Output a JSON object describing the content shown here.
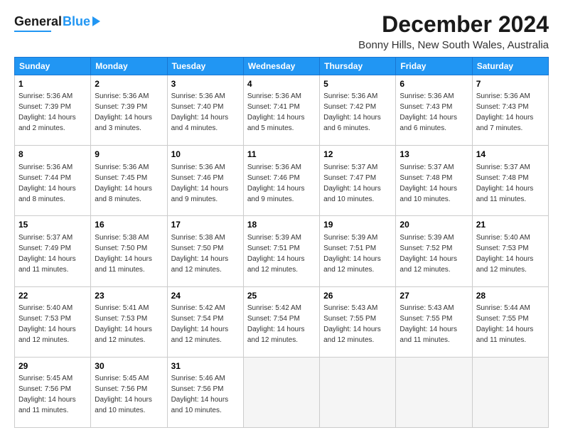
{
  "header": {
    "logo_general": "General",
    "logo_blue": "Blue",
    "title": "December 2024",
    "subtitle": "Bonny Hills, New South Wales, Australia"
  },
  "days_of_week": [
    "Sunday",
    "Monday",
    "Tuesday",
    "Wednesday",
    "Thursday",
    "Friday",
    "Saturday"
  ],
  "weeks": [
    [
      {
        "day": "1",
        "sunrise": "5:36 AM",
        "sunset": "7:39 PM",
        "daylight": "14 hours and 2 minutes."
      },
      {
        "day": "2",
        "sunrise": "5:36 AM",
        "sunset": "7:39 PM",
        "daylight": "14 hours and 3 minutes."
      },
      {
        "day": "3",
        "sunrise": "5:36 AM",
        "sunset": "7:40 PM",
        "daylight": "14 hours and 4 minutes."
      },
      {
        "day": "4",
        "sunrise": "5:36 AM",
        "sunset": "7:41 PM",
        "daylight": "14 hours and 5 minutes."
      },
      {
        "day": "5",
        "sunrise": "5:36 AM",
        "sunset": "7:42 PM",
        "daylight": "14 hours and 6 minutes."
      },
      {
        "day": "6",
        "sunrise": "5:36 AM",
        "sunset": "7:43 PM",
        "daylight": "14 hours and 6 minutes."
      },
      {
        "day": "7",
        "sunrise": "5:36 AM",
        "sunset": "7:43 PM",
        "daylight": "14 hours and 7 minutes."
      }
    ],
    [
      {
        "day": "8",
        "sunrise": "5:36 AM",
        "sunset": "7:44 PM",
        "daylight": "14 hours and 8 minutes."
      },
      {
        "day": "9",
        "sunrise": "5:36 AM",
        "sunset": "7:45 PM",
        "daylight": "14 hours and 8 minutes."
      },
      {
        "day": "10",
        "sunrise": "5:36 AM",
        "sunset": "7:46 PM",
        "daylight": "14 hours and 9 minutes."
      },
      {
        "day": "11",
        "sunrise": "5:36 AM",
        "sunset": "7:46 PM",
        "daylight": "14 hours and 9 minutes."
      },
      {
        "day": "12",
        "sunrise": "5:37 AM",
        "sunset": "7:47 PM",
        "daylight": "14 hours and 10 minutes."
      },
      {
        "day": "13",
        "sunrise": "5:37 AM",
        "sunset": "7:48 PM",
        "daylight": "14 hours and 10 minutes."
      },
      {
        "day": "14",
        "sunrise": "5:37 AM",
        "sunset": "7:48 PM",
        "daylight": "14 hours and 11 minutes."
      }
    ],
    [
      {
        "day": "15",
        "sunrise": "5:37 AM",
        "sunset": "7:49 PM",
        "daylight": "14 hours and 11 minutes."
      },
      {
        "day": "16",
        "sunrise": "5:38 AM",
        "sunset": "7:50 PM",
        "daylight": "14 hours and 11 minutes."
      },
      {
        "day": "17",
        "sunrise": "5:38 AM",
        "sunset": "7:50 PM",
        "daylight": "14 hours and 12 minutes."
      },
      {
        "day": "18",
        "sunrise": "5:39 AM",
        "sunset": "7:51 PM",
        "daylight": "14 hours and 12 minutes."
      },
      {
        "day": "19",
        "sunrise": "5:39 AM",
        "sunset": "7:51 PM",
        "daylight": "14 hours and 12 minutes."
      },
      {
        "day": "20",
        "sunrise": "5:39 AM",
        "sunset": "7:52 PM",
        "daylight": "14 hours and 12 minutes."
      },
      {
        "day": "21",
        "sunrise": "5:40 AM",
        "sunset": "7:53 PM",
        "daylight": "14 hours and 12 minutes."
      }
    ],
    [
      {
        "day": "22",
        "sunrise": "5:40 AM",
        "sunset": "7:53 PM",
        "daylight": "14 hours and 12 minutes."
      },
      {
        "day": "23",
        "sunrise": "5:41 AM",
        "sunset": "7:53 PM",
        "daylight": "14 hours and 12 minutes."
      },
      {
        "day": "24",
        "sunrise": "5:42 AM",
        "sunset": "7:54 PM",
        "daylight": "14 hours and 12 minutes."
      },
      {
        "day": "25",
        "sunrise": "5:42 AM",
        "sunset": "7:54 PM",
        "daylight": "14 hours and 12 minutes."
      },
      {
        "day": "26",
        "sunrise": "5:43 AM",
        "sunset": "7:55 PM",
        "daylight": "14 hours and 12 minutes."
      },
      {
        "day": "27",
        "sunrise": "5:43 AM",
        "sunset": "7:55 PM",
        "daylight": "14 hours and 11 minutes."
      },
      {
        "day": "28",
        "sunrise": "5:44 AM",
        "sunset": "7:55 PM",
        "daylight": "14 hours and 11 minutes."
      }
    ],
    [
      {
        "day": "29",
        "sunrise": "5:45 AM",
        "sunset": "7:56 PM",
        "daylight": "14 hours and 11 minutes."
      },
      {
        "day": "30",
        "sunrise": "5:45 AM",
        "sunset": "7:56 PM",
        "daylight": "14 hours and 10 minutes."
      },
      {
        "day": "31",
        "sunrise": "5:46 AM",
        "sunset": "7:56 PM",
        "daylight": "14 hours and 10 minutes."
      },
      null,
      null,
      null,
      null
    ]
  ],
  "labels": {
    "sunrise": "Sunrise:",
    "sunset": "Sunset:",
    "daylight": "Daylight:"
  }
}
